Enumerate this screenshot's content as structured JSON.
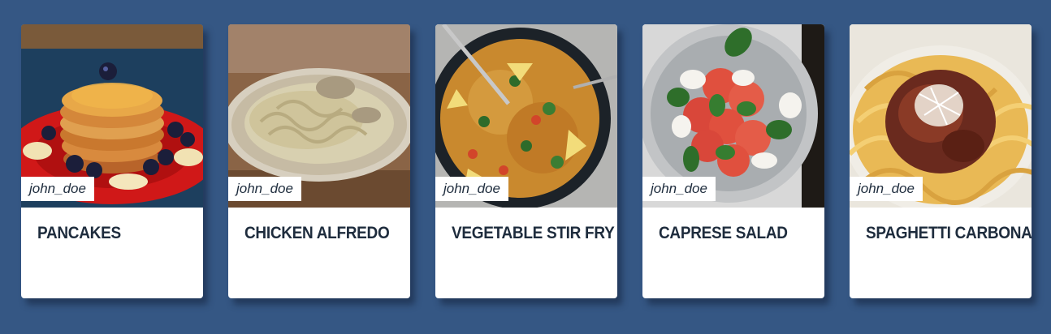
{
  "recipes": [
    {
      "title": "PANCAKES",
      "author": "john_doe",
      "image": "pancakes-photo"
    },
    {
      "title": "CHICKEN ALFREDO",
      "author": "john_doe",
      "image": "chicken-alfredo-photo"
    },
    {
      "title": "VEGETABLE STIR FRY",
      "author": "john_doe",
      "image": "vegetable-stir-fry-photo"
    },
    {
      "title": "CAPRESE SALAD",
      "author": "john_doe",
      "image": "caprese-salad-photo"
    },
    {
      "title": "SPAGHETTI CARBONARA",
      "author": "john_doe",
      "image": "spaghetti-carbonara-photo"
    }
  ],
  "colors": {
    "page_background": "#355784",
    "card_background": "#ffffff",
    "title_text": "#1e2c3d"
  }
}
